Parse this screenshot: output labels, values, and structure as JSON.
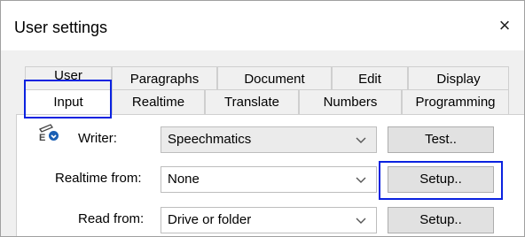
{
  "dialog": {
    "title": "User settings",
    "close_glyph": "×"
  },
  "tabs": {
    "back_row": [
      "User",
      "Paragraphs",
      "Document",
      "Edit",
      "Display"
    ],
    "front_row": [
      "Input",
      "Realtime",
      "Translate",
      "Numbers",
      "Programming"
    ],
    "selected": "Input"
  },
  "form": {
    "writer_label": "Writer:",
    "writer_value": "Speechmatics",
    "test_button": "Test..",
    "realtime_label": "Realtime from:",
    "realtime_value": "None",
    "realtime_setup_button": "Setup..",
    "read_label": "Read from:",
    "read_value": "Drive or folder",
    "read_setup_button": "Setup.."
  },
  "icons": {
    "close": "close-icon",
    "writer": "writer-icon",
    "dropdown": "chevron-down-icon"
  },
  "colors": {
    "highlight": "#0a22e0"
  }
}
